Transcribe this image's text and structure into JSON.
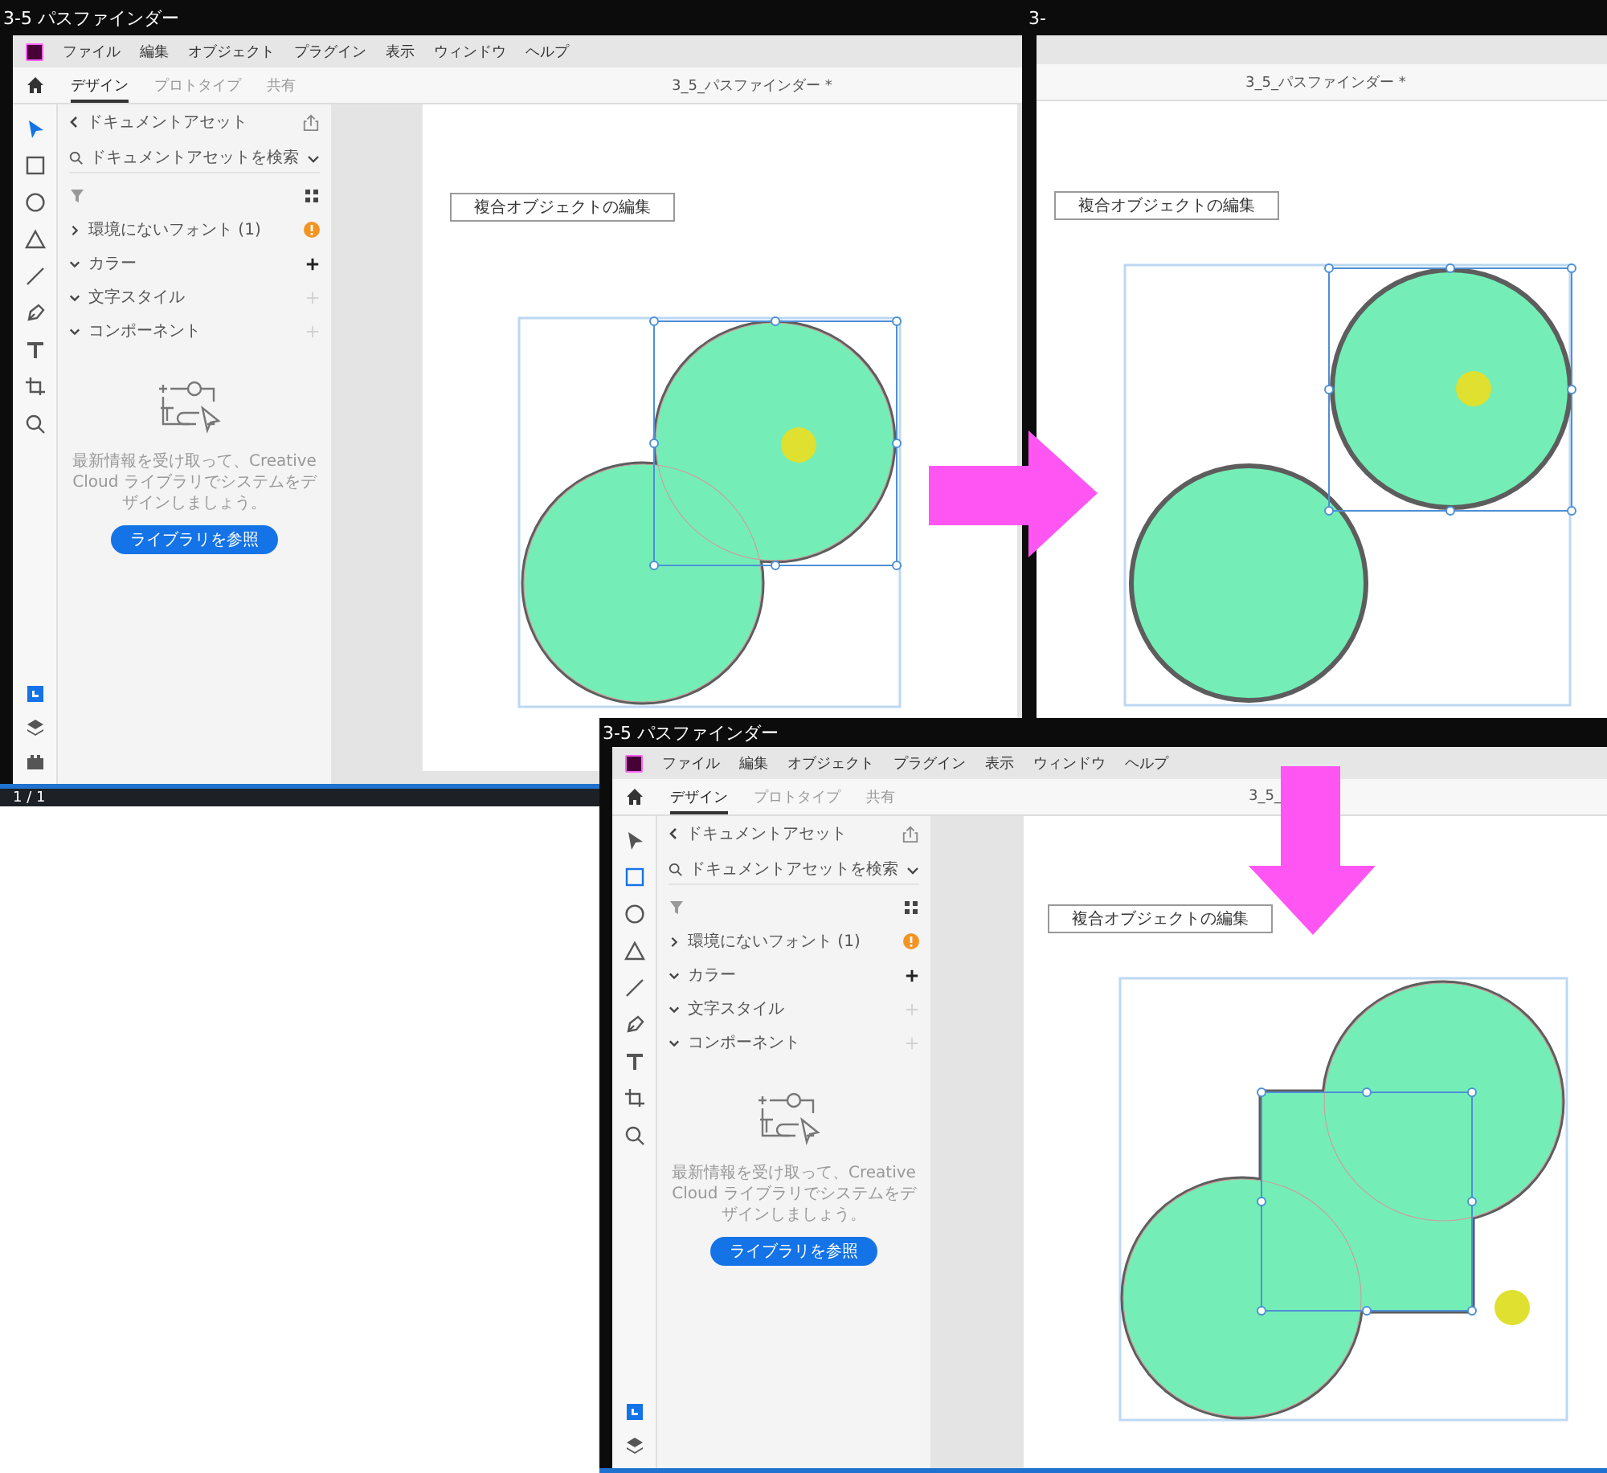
{
  "windows": [
    {
      "kind": "full",
      "title": "3-5 パスファインダー",
      "menu": [
        "ファイル",
        "編集",
        "オブジェクト",
        "プラグイン",
        "表示",
        "ウィンドウ",
        "ヘルプ"
      ],
      "tabs": [
        {
          "label": "デザイン",
          "selected": true
        },
        {
          "label": "プロトタイプ",
          "selected": false
        },
        {
          "label": "共有",
          "selected": false
        }
      ],
      "document": "3_5_パスファインダー *",
      "tools": [
        {
          "kind": "select",
          "selected": true
        },
        {
          "kind": "rectangle",
          "selected": false
        },
        {
          "kind": "ellipse",
          "selected": false
        },
        {
          "kind": "polygon",
          "selected": false
        },
        {
          "kind": "line",
          "selected": false
        },
        {
          "kind": "pen",
          "selected": false
        },
        {
          "kind": "text",
          "selected": false
        },
        {
          "kind": "artboard",
          "selected": false
        },
        {
          "kind": "zoom",
          "selected": false
        }
      ],
      "panel_tools": [
        {
          "kind": "assets",
          "selected": true
        },
        {
          "kind": "layers",
          "selected": false
        },
        {
          "kind": "plugins",
          "selected": false
        }
      ],
      "assets": {
        "title": "ドキュメントアセット",
        "search": {
          "placeholder": "ドキュメントアセットを検索"
        },
        "sections": [
          {
            "label": "環境にないフォント (1)",
            "kind": "warning",
            "expanded": false
          },
          {
            "label": "カラー",
            "kind": "add",
            "expanded": true,
            "disabled": false
          },
          {
            "label": "文字スタイル",
            "kind": "add",
            "expanded": true,
            "disabled": true
          },
          {
            "label": "コンポーネント",
            "kind": "add",
            "expanded": true,
            "disabled": true
          }
        ],
        "message": "最新情報を受け取って、Creative Cloud ライブラリでシステムをデザインしましょう。",
        "button": "ライブラリを参照"
      },
      "canvas": {
        "label": "複合オブジェクトの編集",
        "kind": "compound"
      },
      "page_indicator": "1 / 1"
    },
    {
      "kind": "partial",
      "title": "3-",
      "document": "3_5_パスファインダー *",
      "canvas": {
        "label": "複合オブジェクトの編集",
        "kind": "separated"
      }
    },
    {
      "kind": "full",
      "title": "3-5 パスファインダー",
      "menu": [
        "ファイル",
        "編集",
        "オブジェクト",
        "プラグイン",
        "表示",
        "ウィンドウ",
        "ヘルプ"
      ],
      "tabs": [
        {
          "label": "デザイン",
          "selected": true
        },
        {
          "label": "プロトタイプ",
          "selected": false
        },
        {
          "label": "共有",
          "selected": false
        }
      ],
      "document": "3_5_",
      "tools": [
        {
          "kind": "select",
          "selected": false
        },
        {
          "kind": "rectangle",
          "selected": true
        },
        {
          "kind": "ellipse",
          "selected": false
        },
        {
          "kind": "polygon",
          "selected": false
        },
        {
          "kind": "line",
          "selected": false
        },
        {
          "kind": "pen",
          "selected": false
        },
        {
          "kind": "text",
          "selected": false
        },
        {
          "kind": "artboard",
          "selected": false
        },
        {
          "kind": "zoom",
          "selected": false
        }
      ],
      "panel_tools": [
        {
          "kind": "assets",
          "selected": true
        },
        {
          "kind": "layers",
          "selected": false
        }
      ],
      "assets": {
        "title": "ドキュメントアセット",
        "search": {
          "placeholder": "ドキュメントアセットを検索"
        },
        "sections": [
          {
            "label": "環境にないフォント (1)",
            "kind": "warning",
            "expanded": false
          },
          {
            "label": "カラー",
            "kind": "add",
            "expanded": true,
            "disabled": false
          },
          {
            "label": "文字スタイル",
            "kind": "add",
            "expanded": true,
            "disabled": true
          },
          {
            "label": "コンポーネント",
            "kind": "add",
            "expanded": true,
            "disabled": true
          }
        ],
        "message": "最新情報を受け取って、Creative Cloud ライブラリでシステムをデザインしましょう。",
        "button": "ライブラリを参照"
      },
      "canvas": {
        "label": "複合オブジェクトの編集",
        "kind": "united"
      }
    }
  ],
  "arrows": [
    {
      "kind": "right"
    },
    {
      "kind": "down"
    }
  ]
}
